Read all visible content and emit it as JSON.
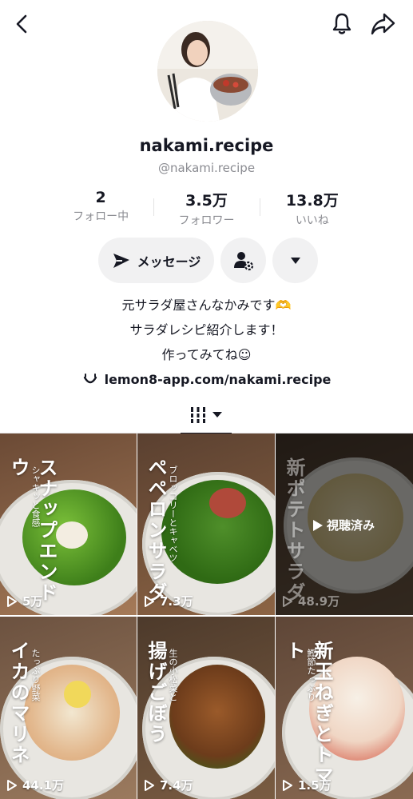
{
  "header": {
    "back_icon": "chevron-left-icon",
    "bell_icon": "bell-icon",
    "share_icon": "share-arrow-icon"
  },
  "profile": {
    "username": "nakami.recipe",
    "handle": "@nakami.recipe"
  },
  "stats": [
    {
      "value": "2",
      "label": "フォロー中"
    },
    {
      "value": "3.5万",
      "label": "フォロワー"
    },
    {
      "value": "13.8万",
      "label": "いいね"
    }
  ],
  "actions": {
    "message_label": "メッセージ"
  },
  "bio": {
    "lines": [
      "元サラダ屋さんなかみです🫶",
      "サラダレシピ紹介します！",
      "作ってみてね☺"
    ],
    "link": "lemon8-app.com/nakami.recipe"
  },
  "videos": [
    {
      "title": "スナップエンドウ",
      "subtitle": "シャキッと食感",
      "views": "5万",
      "watched": false
    },
    {
      "title": "ペペロンサラダ",
      "subtitle": "ブロッコリーとキャベツ",
      "views": "7.3万",
      "watched": false
    },
    {
      "title": "新ポテトサラダ",
      "subtitle": "",
      "views": "48.9万",
      "watched": true,
      "watched_label": "視聴済み"
    },
    {
      "title": "イカのマリネ",
      "subtitle": "たっぷり野菜",
      "views": "44.1万",
      "watched": false
    },
    {
      "title": "揚げごぼう",
      "subtitle": "生の小松菜と",
      "views": "7.4万",
      "watched": false
    },
    {
      "title": "新玉ねぎとトマト",
      "subtitle": "鰹節たっぷり",
      "views": "1.5万",
      "watched": false
    }
  ],
  "colors": {
    "text": "#161823",
    "secondary": "#8a8b91",
    "button_bg": "#f1f1f2"
  }
}
